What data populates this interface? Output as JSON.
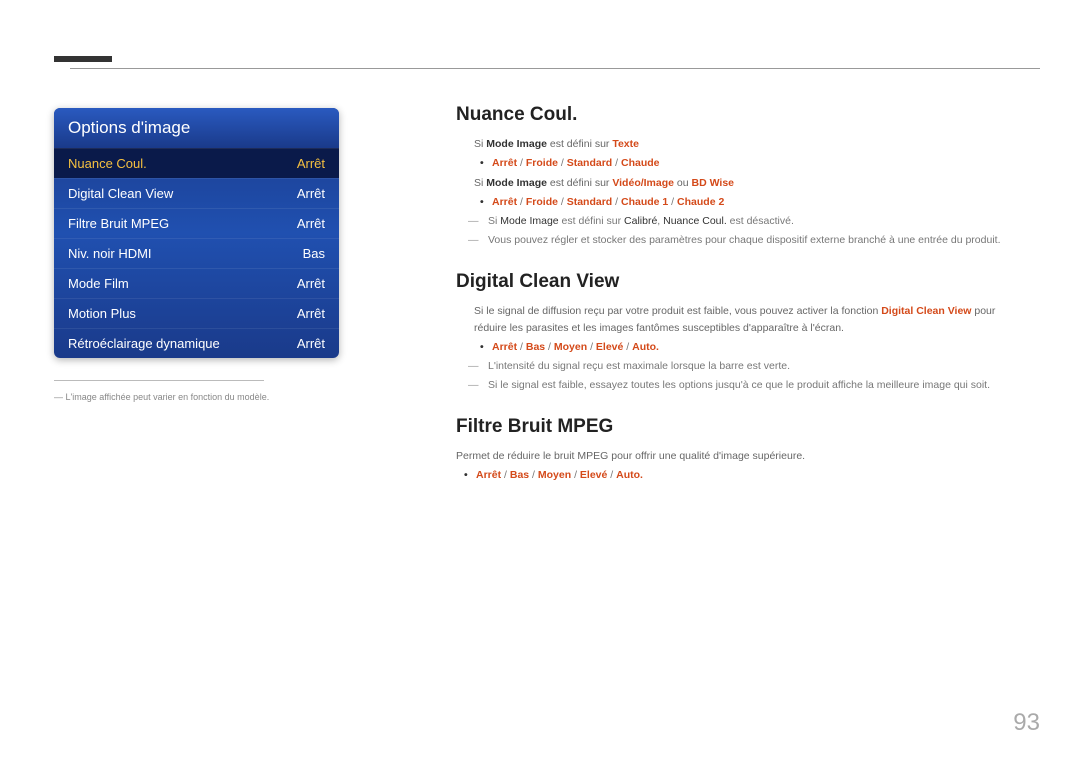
{
  "page_number": "93",
  "panel": {
    "title": "Options d'image",
    "items": [
      {
        "label": "Nuance Coul.",
        "value": "Arrêt",
        "selected": true
      },
      {
        "label": "Digital Clean View",
        "value": "Arrêt",
        "selected": false
      },
      {
        "label": "Filtre Bruit MPEG",
        "value": "Arrêt",
        "selected": false
      },
      {
        "label": "Niv. noir HDMI",
        "value": "Bas",
        "selected": false
      },
      {
        "label": "Mode Film",
        "value": "Arrêt",
        "selected": false
      },
      {
        "label": "Motion Plus",
        "value": "Arrêt",
        "selected": false
      },
      {
        "label": "Rétroéclairage dynamique",
        "value": "Arrêt",
        "selected": false
      }
    ],
    "caption_prefix": "―",
    "caption": "L'image affichée peut varier en fonction du modèle."
  },
  "sections": {
    "nuance": {
      "title": "Nuance Coul.",
      "cond1_a": "Si ",
      "cond1_b": "Mode Image",
      "cond1_c": " est défini sur ",
      "cond1_d": "Texte",
      "bullet1": {
        "a": "Arrêt",
        "b": "Froide",
        "c": "Standard",
        "d": "Chaude"
      },
      "cond2_a": "Si ",
      "cond2_b": "Mode Image",
      "cond2_c": " est défini sur ",
      "cond2_d": "Vidéo/Image",
      "cond2_e": " ou ",
      "cond2_f": "BD Wise",
      "bullet2": {
        "a": "Arrêt",
        "b": "Froide",
        "c": "Standard",
        "d": "Chaude 1",
        "e": "Chaude 2"
      },
      "note1_a": "Si ",
      "note1_b": "Mode Image",
      "note1_c": " est défini sur ",
      "note1_d": "Calibré",
      "note1_e": ", ",
      "note1_f": "Nuance Coul.",
      "note1_g": " est désactivé.",
      "note2": "Vous pouvez régler et stocker des paramètres pour chaque dispositif externe branché à une entrée du produit."
    },
    "dcv": {
      "title": "Digital Clean View",
      "body_a": "Si le signal de diffusion reçu par votre produit est faible, vous pouvez activer la fonction ",
      "body_b": "Digital Clean View",
      "body_c": " pour réduire les parasites et les images fantômes susceptibles d'apparaître à l'écran.",
      "bullet": {
        "a": "Arrêt",
        "b": "Bas",
        "c": "Moyen",
        "d": "Elevé",
        "e": "Auto."
      },
      "note1": "L'intensité du signal reçu est maximale lorsque la barre est verte.",
      "note2": "Si le signal est faible, essayez toutes les options jusqu'à ce que le produit affiche la meilleure image qui soit."
    },
    "mpeg": {
      "title": "Filtre Bruit MPEG",
      "body": "Permet de réduire le bruit MPEG pour offrir une qualité d'image supérieure.",
      "bullet": {
        "a": "Arrêt",
        "b": "Bas",
        "c": "Moyen",
        "d": "Elevé",
        "e": "Auto."
      }
    }
  }
}
